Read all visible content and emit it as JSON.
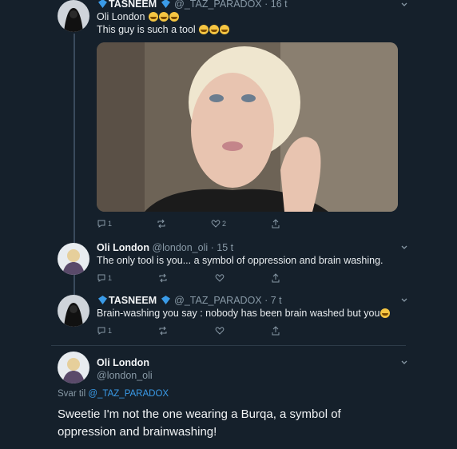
{
  "tweets": [
    {
      "name": "TASNEEM",
      "handle": "@_TAZ_PARADOX",
      "time": "· 16 t",
      "line1": "Oli London",
      "line2": "This guy is such a tool",
      "counts": {
        "reply": "1",
        "retweet": "",
        "like": "2"
      }
    },
    {
      "name": "Oli London",
      "handle": "@london_oli",
      "time": "· 15 t",
      "text": "The only tool is you... a symbol of oppression and brain washing.",
      "counts": {
        "reply": "1"
      }
    },
    {
      "name": "TASNEEM",
      "handle": "@_TAZ_PARADOX",
      "time": "· 7 t",
      "text": "Brain-washing you say : nobody has been brain washed but you",
      "counts": {
        "reply": "1"
      }
    }
  ],
  "main_tweet": {
    "name": "Oli London",
    "handle": "@london_oli",
    "reply_prefix": "Svar til",
    "reply_handle": "@_TAZ_PARADOX",
    "text": "Sweetie I'm not the one wearing a Burqa, a symbol of oppression and brainwashing!"
  },
  "colors": {
    "background": "#15202b",
    "link": "#3a9be8",
    "muted": "#8899a6",
    "verified": "#3a9be8"
  },
  "icons": [
    "verified-icon",
    "emoji-laughing-icon",
    "reply-icon",
    "retweet-icon",
    "like-icon",
    "share-icon",
    "chevron-down-icon"
  ]
}
